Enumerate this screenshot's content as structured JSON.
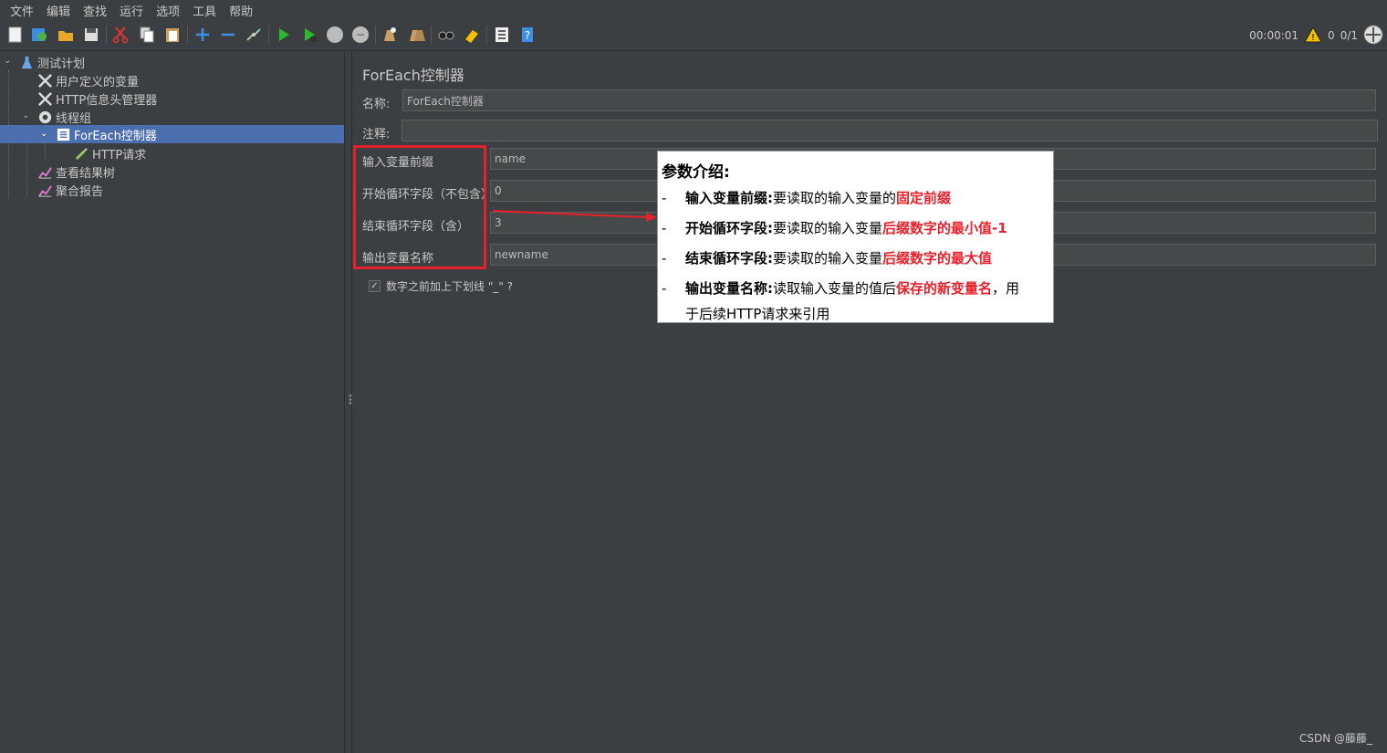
{
  "menu": [
    "文件",
    "编辑",
    "查找",
    "运行",
    "选项",
    "工具",
    "帮助"
  ],
  "toolbar_icons": [
    "new-icon",
    "templates-icon",
    "open-icon",
    "save-icon",
    "cut-icon",
    "copy-icon",
    "paste-icon",
    "expand-icon",
    "collapse-icon",
    "toggle-icon",
    "start-icon",
    "start-no-pause-icon",
    "stop-icon",
    "shutdown-icon",
    "clear-icon",
    "clear-all-icon",
    "search-icon",
    "reset-search-icon",
    "function-helper-icon",
    "help-icon"
  ],
  "status": {
    "timer": "00:00:01",
    "warnings": "0",
    "threads": "0/1"
  },
  "tree": {
    "test_plan": "测试计划",
    "user_vars": "用户定义的变量",
    "header_mgr": "HTTP信息头管理器",
    "thread_group": "线程组",
    "foreach": "ForEach控制器",
    "http_request": "HTTP请求",
    "result_tree": "查看结果树",
    "aggregate": "聚合报告"
  },
  "panel": {
    "title": "ForEach控制器",
    "name_label": "名称:",
    "name_value": "ForEach控制器",
    "comment_label": "注释:",
    "comment_value": "",
    "input_prefix_label": "输入变量前缀",
    "input_prefix_value": "name",
    "start_label": "开始循环字段（不包含）",
    "start_value": "0",
    "end_label": "结束循环字段（含）",
    "end_value": "3",
    "output_label": "输出变量名称",
    "output_value": "newname",
    "checkbox_label": "数字之前加上下划线 \"_\" ?",
    "checkbox_checked": true
  },
  "callout": {
    "title": "参数介绍:",
    "dash": "-",
    "r1_key": "输入变量前缀:",
    "r1_text": "要读取的输入变量的",
    "r1_red": "固定前缀",
    "r2_key": "开始循环字段:",
    "r2_text": "要读取的输入变量",
    "r2_red": "后缀数字的最小值-1",
    "r3_key": "结束循环字段:",
    "r3_text": "要读取的输入变量",
    "r3_red": "后缀数字的最大值",
    "r4_key": "输出变量名称:",
    "r4_text": "读取输入变量的值后",
    "r4_red": "保存的新变量名",
    "r4_tail": "，用",
    "r4_line2": "于后续HTTP请求来引用"
  },
  "watermark": "CSDN @藤藤_"
}
